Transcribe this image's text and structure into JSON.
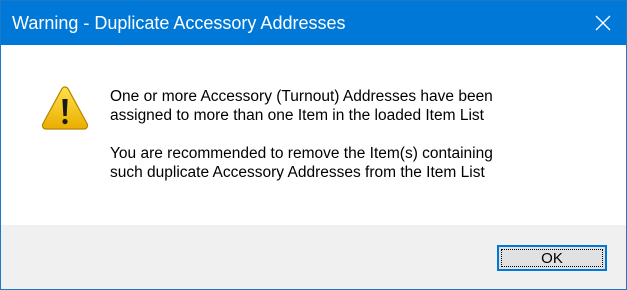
{
  "dialog": {
    "title": "Warning - Duplicate Accessory Addresses",
    "close_icon": "close-icon",
    "icon": "warning-triangle-icon",
    "message_paragraph_1": "One or more Accessory (Turnout) Addresses have been\nassigned to more than one Item in the loaded Item List",
    "message_paragraph_2": "You are recommended to remove the Item(s) containing\nsuch duplicate Accessory Addresses from the Item List",
    "ok_label": "OK"
  },
  "colors": {
    "titlebar": "#0078d7",
    "footer": "#f0f0f0",
    "warning_fill": "#f5c400",
    "button_face": "#e1e1e1"
  }
}
